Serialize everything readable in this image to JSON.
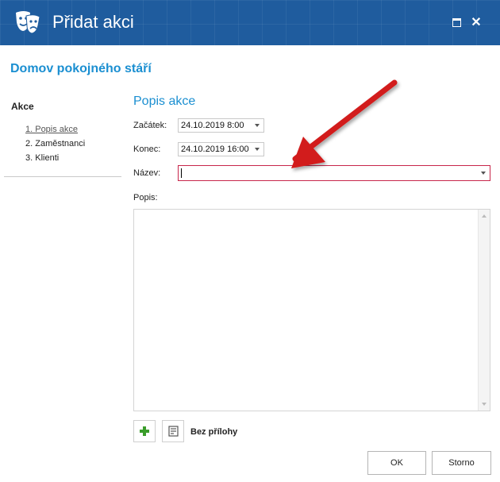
{
  "window": {
    "title": "Přidat akci"
  },
  "organization": "Domov pokojného stáří",
  "nav": {
    "title": "Akce",
    "items": [
      {
        "label": "1. Popis akce",
        "active": true
      },
      {
        "label": "2. Zaměstnanci",
        "active": false
      },
      {
        "label": "3. Klienti",
        "active": false
      }
    ]
  },
  "form": {
    "section_title": "Popis akce",
    "start": {
      "label": "Začátek:",
      "value": "24.10.2019 8:00"
    },
    "end": {
      "label": "Konec:",
      "value": "24.10.2019 16:00"
    },
    "name": {
      "label": "Název:",
      "value": ""
    },
    "description": {
      "label": "Popis:",
      "value": ""
    }
  },
  "attachments": {
    "status": "Bez přílohy"
  },
  "buttons": {
    "ok": "OK",
    "cancel": "Storno"
  },
  "colors": {
    "titlebar": "#1f5c9e",
    "accent": "#1b8fd1",
    "error_border": "#c8264b",
    "annotation_arrow": "#d21e1e"
  },
  "icons": {
    "app": "theater-masks-icon",
    "maximize": "maximize-icon",
    "close": "close-icon",
    "add_attachment": "plus-icon",
    "attachment_list": "document-icon"
  }
}
